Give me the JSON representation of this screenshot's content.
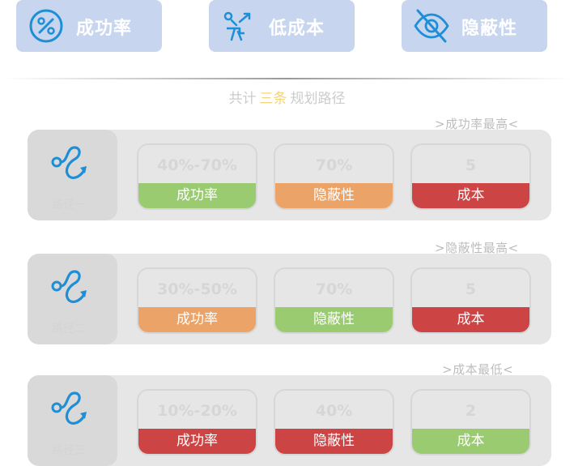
{
  "colors": {
    "tab_bg": "#c7d5ee",
    "icon_blue": "#1e8fd6",
    "good": "#9acb70",
    "medium": "#eba367",
    "bad": "#cd4444",
    "highlight": "#f3d37a"
  },
  "tabs": [
    {
      "label": "成功率",
      "icon": "percent-circle-icon"
    },
    {
      "label": "低成本",
      "icon": "route-flag-icon"
    },
    {
      "label": "隐蔽性",
      "icon": "eye-off-icon"
    }
  ],
  "summary": {
    "prefix": "共计",
    "count": "三条",
    "suffix": "规划路径"
  },
  "routes": [
    {
      "caption": ">成功率最高<",
      "name": "路径一",
      "icon": "route-path-icon",
      "metrics": [
        {
          "value": "40%-70%",
          "label": "成功率",
          "status": "good"
        },
        {
          "value": "70%",
          "label": "隐蔽性",
          "status": "medium"
        },
        {
          "value": "5",
          "label": "成本",
          "status": "bad"
        }
      ]
    },
    {
      "caption": ">隐蔽性最高<",
      "name": "路径二",
      "icon": "route-path-icon",
      "metrics": [
        {
          "value": "30%-50%",
          "label": "成功率",
          "status": "medium"
        },
        {
          "value": "70%",
          "label": "隐蔽性",
          "status": "good"
        },
        {
          "value": "5",
          "label": "成本",
          "status": "bad"
        }
      ]
    },
    {
      "caption": ">成本最低<",
      "name": "路径三",
      "icon": "route-path-icon",
      "metrics": [
        {
          "value": "10%-20%",
          "label": "成功率",
          "status": "bad"
        },
        {
          "value": "40%",
          "label": "隐蔽性",
          "status": "bad"
        },
        {
          "value": "2",
          "label": "成本",
          "status": "good"
        }
      ]
    }
  ]
}
